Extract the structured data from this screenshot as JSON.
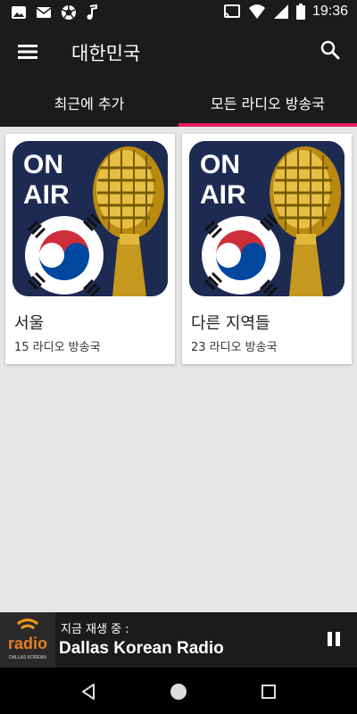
{
  "status_bar": {
    "time": "19:36",
    "icons": [
      "photo-icon",
      "mail-icon",
      "aperture-icon",
      "music-note-icon",
      "cast-icon",
      "wifi-icon",
      "signal-icon",
      "battery-icon"
    ]
  },
  "app_bar": {
    "title": "대한민국",
    "icons": [
      "menu-icon",
      "search-icon"
    ]
  },
  "tabs": [
    {
      "label": "최근에 추가",
      "selected": false
    },
    {
      "label": "모든 라디오 방송국",
      "selected": true
    }
  ],
  "colors": {
    "bar_bg": "#1b1b1b",
    "accent": "#e91e63",
    "content_bg": "#e6e6e6",
    "card_art_bg": "#1d2b52",
    "gold": "#d4a516"
  },
  "cards": [
    {
      "art_text": [
        "ON",
        "AIR"
      ],
      "title": "서울",
      "subtitle": "15 라디오 방송국"
    },
    {
      "art_text": [
        "ON",
        "AIR"
      ],
      "title": "다른 지역들",
      "subtitle": "23 라디오 방송국"
    }
  ],
  "player": {
    "now_playing_label": "지금 재생 중 :",
    "station": "Dallas Korean Radio",
    "logo_text": "radio",
    "logo_subtext": "DALLAS KOREAN",
    "icons": [
      "pause-icon"
    ]
  },
  "nav_bar": {
    "icons": [
      "back-icon",
      "home-icon",
      "recents-icon"
    ]
  }
}
